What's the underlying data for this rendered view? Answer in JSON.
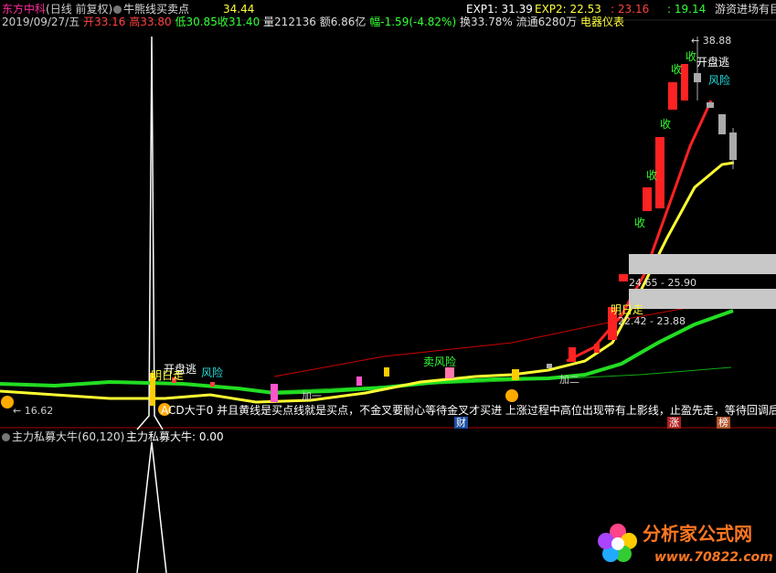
{
  "header": {
    "stock_name": "东方中科",
    "period": "(日线 前复权)",
    "indicator_name": "牛熊线买卖点",
    "indicator_value": "34.44",
    "exp1_label": "EXP1: 31.39",
    "exp2_label": "EXP2: 22.53",
    "exp3_label": ": 23.16",
    "exp4_label": ": 19.14",
    "right_title": "游资进场有目",
    "colors": {
      "stock": "#ff2a9b",
      "exp1": "#ffffff",
      "exp2": "#ffff3a",
      "exp3": "#ff4040",
      "exp4": "#33ff33"
    }
  },
  "quote": {
    "date": "2019/09/27/五",
    "open_label": "开",
    "open": "33.16",
    "high_label": "高",
    "high": "33.80",
    "low_label": "低",
    "low": "30.85",
    "close_label": "收",
    "close": "31.40",
    "volume_label": "量",
    "volume": "212136",
    "amount_label": "额",
    "amount": "6.86亿",
    "change_label": "幅",
    "change": "-1.59(-4.82%)",
    "turnover_label": "换",
    "turnover": "33.78%",
    "float_label": "流通",
    "float_value": "6280万",
    "sector": "电器仪表"
  },
  "price_labels": {
    "high_mark": "38.88",
    "low_mark": "16.62",
    "zone1": "24.65 - 25.90",
    "zone2": "22.42 - 23.88"
  },
  "annotations": {
    "shou": "收",
    "kaipan": "开盘逃",
    "fengxian": "风险",
    "mingri": "明日走",
    "mai_fengxian": "卖风险",
    "jia1": "加一",
    "jia2": "加二",
    "cai": "财",
    "zhang": "涨",
    "bang": "榜"
  },
  "ticker_text": "ACD大于0 并且黄线是买点线就是买点，不金叉要耐心等待金叉才买进 上涨过程中高位出现带有上影线，止盈先走，等待回调后",
  "lower_panel": {
    "indicator_name": "主力私募大牛",
    "params": "(60,120)",
    "value_label": "主力私募大牛: 0.00"
  },
  "watermark": {
    "brand": "分析家公式网",
    "url": "www.70822.com"
  }
}
